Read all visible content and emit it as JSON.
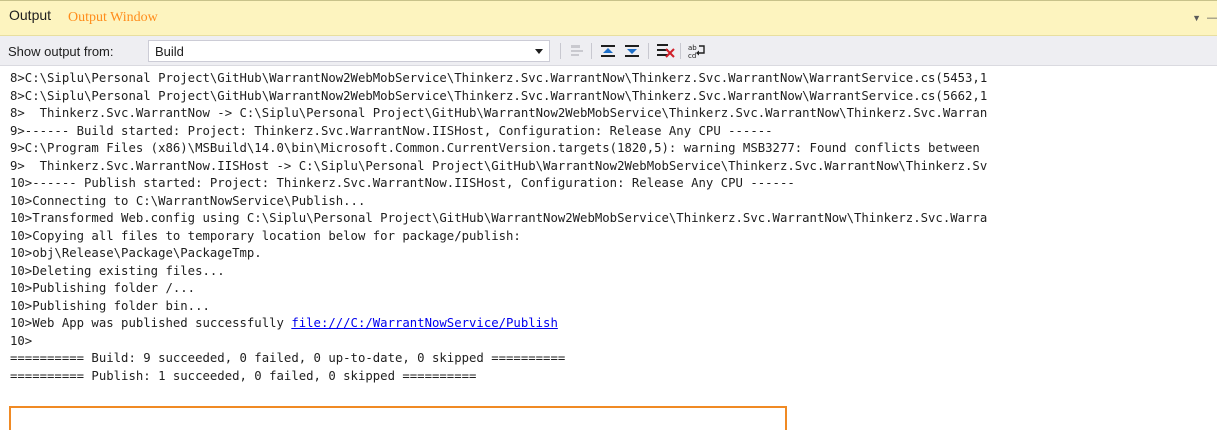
{
  "window": {
    "title": "Output",
    "annotation": "Output Window",
    "dropdown_icon": "caret-down-icon",
    "pin_icon": "pin-icon"
  },
  "toolbar": {
    "show_output_label": "Show output from:",
    "source_value": "Build",
    "buttons": [
      {
        "name": "find-message-in-code-icon",
        "enabled": false
      },
      {
        "name": "go-to-previous-message-icon",
        "enabled": true
      },
      {
        "name": "go-to-next-message-icon",
        "enabled": true
      },
      {
        "name": "clear-all-icon",
        "enabled": true
      },
      {
        "name": "toggle-word-wrap-icon",
        "enabled": true
      }
    ]
  },
  "output": {
    "lines": [
      {
        "text": "8>C:\\Siplu\\Personal Project\\GitHub\\WarrantNow2WebMobService\\Thinkerz.Svc.WarrantNow\\Thinkerz.Svc.WarrantNow\\WarrantService.cs(5453,1"
      },
      {
        "text": "8>C:\\Siplu\\Personal Project\\GitHub\\WarrantNow2WebMobService\\Thinkerz.Svc.WarrantNow\\Thinkerz.Svc.WarrantNow\\WarrantService.cs(5662,1"
      },
      {
        "text": "8>  Thinkerz.Svc.WarrantNow -> C:\\Siplu\\Personal Project\\GitHub\\WarrantNow2WebMobService\\Thinkerz.Svc.WarrantNow\\Thinkerz.Svc.Warran"
      },
      {
        "text": "9>------ Build started: Project: Thinkerz.Svc.WarrantNow.IISHost, Configuration: Release Any CPU ------"
      },
      {
        "text": "9>C:\\Program Files (x86)\\MSBuild\\14.0\\bin\\Microsoft.Common.CurrentVersion.targets(1820,5): warning MSB3277: Found conflicts between"
      },
      {
        "text": "9>  Thinkerz.Svc.WarrantNow.IISHost -> C:\\Siplu\\Personal Project\\GitHub\\WarrantNow2WebMobService\\Thinkerz.Svc.WarrantNow\\Thinkerz.Sv"
      },
      {
        "text": "10>------ Publish started: Project: Thinkerz.Svc.WarrantNow.IISHost, Configuration: Release Any CPU ------"
      },
      {
        "text": "10>Connecting to C:\\WarrantNowService\\Publish..."
      },
      {
        "text": "10>Transformed Web.config using C:\\Siplu\\Personal Project\\GitHub\\WarrantNow2WebMobService\\Thinkerz.Svc.WarrantNow\\Thinkerz.Svc.Warra"
      },
      {
        "text": "10>Copying all files to temporary location below for package/publish:"
      },
      {
        "text": "10>obj\\Release\\Package\\PackageTmp."
      },
      {
        "text": "10>Deleting existing files..."
      },
      {
        "text": "10>Publishing folder /..."
      },
      {
        "text": "10>Publishing folder bin..."
      },
      {
        "text": "10>Web App was published successfully ",
        "link": "file:///C:/WarrantNowService/Publish"
      },
      {
        "text": "10>"
      },
      {
        "text": "========== Build: 9 succeeded, 0 failed, 0 up-to-date, 0 skipped =========="
      },
      {
        "text": "========== Publish: 1 succeeded, 0 failed, 0 skipped =========="
      }
    ]
  },
  "colors": {
    "titlebar_bg": "#fdf4bf",
    "annotation": "#ff8c1a",
    "highlight_border": "#f08a24",
    "link": "#0000ee"
  }
}
